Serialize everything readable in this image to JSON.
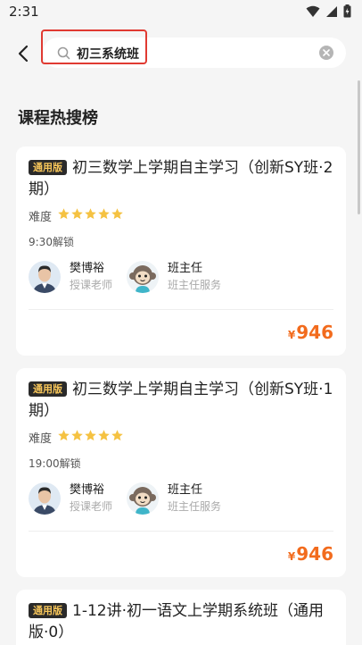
{
  "status_bar": {
    "time": "2:31",
    "icons": [
      "wifi-icon",
      "signal-icon",
      "battery-icon"
    ]
  },
  "search": {
    "query": "初三系统班"
  },
  "section_title": "课程热搜榜",
  "colors": {
    "price": "#f26b1d",
    "star": "#f5c242",
    "badge_bg": "#2a2a2a",
    "badge_text": "#f7c65a",
    "highlight": "#e03a32"
  },
  "courses": [
    {
      "badge": "通用版",
      "title": "初三数学上学期自主学习（创新SY班·2期）",
      "difficulty_label": "难度",
      "rating": 5,
      "unlock_time": "9:30解锁",
      "teacher": {
        "name": "樊博裕",
        "role": "授课老师"
      },
      "head_teacher": {
        "name": "班主任",
        "role": "班主任服务"
      },
      "price_symbol": "¥",
      "price": "946"
    },
    {
      "badge": "通用版",
      "title": "初三数学上学期自主学习（创新SY班·1期）",
      "difficulty_label": "难度",
      "rating": 5,
      "unlock_time": "19:00解锁",
      "teacher": {
        "name": "樊博裕",
        "role": "授课老师"
      },
      "head_teacher": {
        "name": "班主任",
        "role": "班主任服务"
      },
      "price_symbol": "¥",
      "price": "946"
    },
    {
      "badge": "通用版",
      "title": "1-12讲·初一语文上学期系统班（通用版·0）"
    }
  ]
}
